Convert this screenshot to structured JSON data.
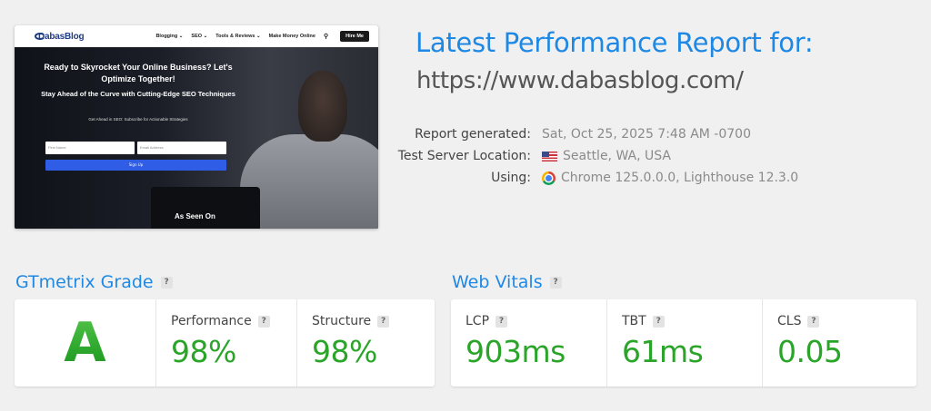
{
  "screenshot": {
    "logo": "DabasBlog",
    "nav_items": [
      "Blogging ⌄",
      "SEO ⌄",
      "Tools & Reviews ⌄",
      "Make Money Online"
    ],
    "hire_button": "Hire Me",
    "headline": "Ready to Skyrocket Your Online Business? Let's Optimize Together!",
    "subheadline": "Stay Ahead of the Curve with Cutting-Edge SEO Techniques",
    "tagline": "Get Ahead in SEO: Subscribe for Actionable Strategies",
    "first_name_placeholder": "First Name",
    "email_placeholder": "Email Address",
    "submit_label": "Sign Up",
    "as_seen_on": "As Seen On"
  },
  "report": {
    "title": "Latest Performance Report for:",
    "url": "https://www.dabasblog.com/",
    "generated_label": "Report generated:",
    "generated_value": "Sat, Oct 25, 2025 7:48 AM -0700",
    "location_label": "Test Server Location:",
    "location_value": "Seattle, WA, USA",
    "using_label": "Using:",
    "using_value": "Chrome 125.0.0.0, Lighthouse 12.3.0"
  },
  "grade": {
    "title": "GTmetrix Grade",
    "letter": "A",
    "performance_label": "Performance",
    "performance_value": "98%",
    "structure_label": "Structure",
    "structure_value": "98%"
  },
  "vitals": {
    "title": "Web Vitals",
    "lcp_label": "LCP",
    "lcp_value": "903ms",
    "tbt_label": "TBT",
    "tbt_value": "61ms",
    "cls_label": "CLS",
    "cls_value": "0.05"
  },
  "help_glyph": "?",
  "colors": {
    "accent_blue": "#1e88e5",
    "good_green": "#2aa52a",
    "page_bg": "#f0f0f0"
  }
}
